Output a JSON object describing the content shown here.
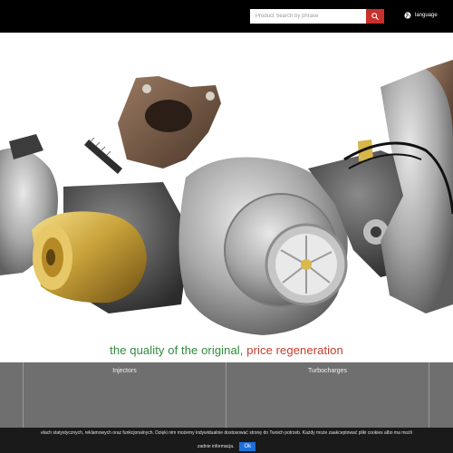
{
  "header": {
    "search": {
      "placeholder": "Product Search by phrase",
      "value": ""
    },
    "search_button_icon": "search-icon",
    "language": {
      "icon": "globe-icon",
      "label": "language"
    }
  },
  "hero": {
    "slogan_part1": "the quality of the original,",
    "slogan_part2": "price regeneration",
    "colors": {
      "slogan_green": "#2f8a3c",
      "slogan_red": "#c43c2a"
    }
  },
  "categories": {
    "items": [
      {
        "label": ""
      },
      {
        "label": "Injectors"
      },
      {
        "label": "Turbocharges"
      },
      {
        "label": ""
      }
    ]
  },
  "cookie_bar": {
    "text": "elach statystycznych, reklamowych oraz funkcjonalnych. Dzięki nim możemy indywidualnie dostosować stronę do Twoich potrzeb. Każdy może zaakceptować pliki cookies albo ma możli",
    "more_label": "zadnie informacja.",
    "ok_label": "Ok"
  },
  "colors": {
    "topbar": "#000000",
    "search_button": "#c9302c",
    "category_strip": "#6f6f6f",
    "cookie_bar": "#1a1a1a",
    "ok_button": "#1f6fd8"
  }
}
